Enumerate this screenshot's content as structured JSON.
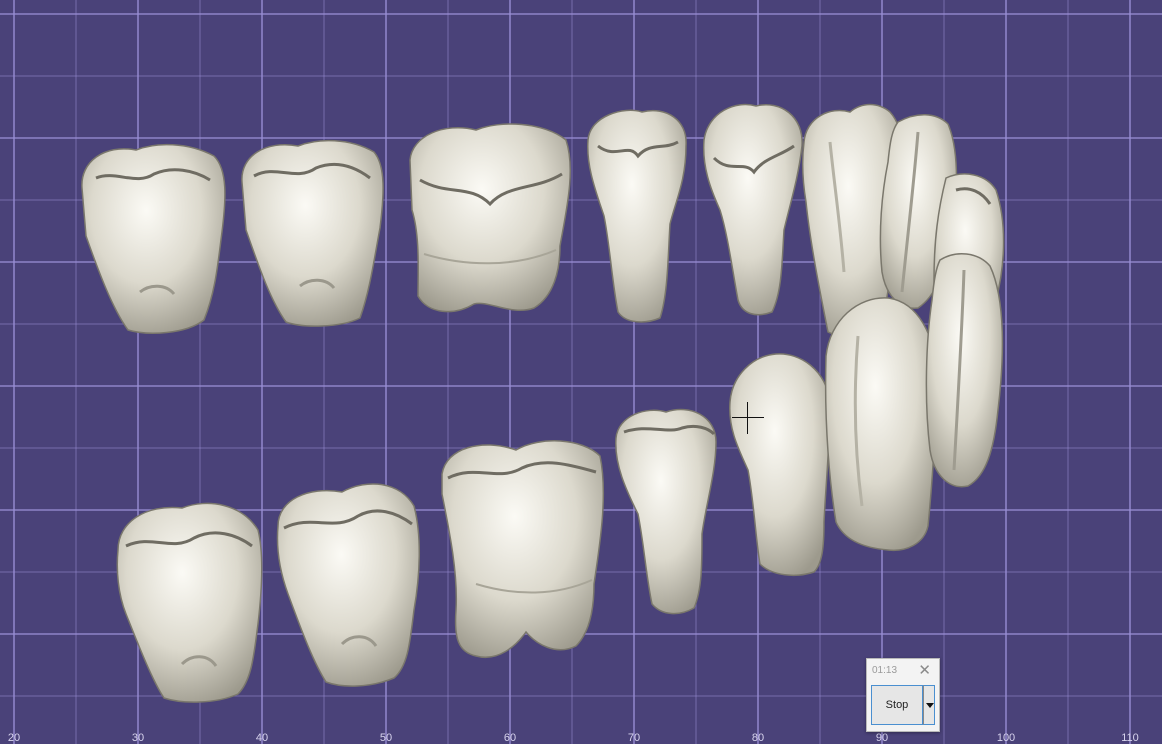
{
  "viewer": {
    "background": "#4a4279",
    "grid_color": "#9a8fd6",
    "tooth_color": "#e6e4da"
  },
  "ruler": {
    "labels": [
      "20",
      "30",
      "40",
      "50",
      "60",
      "70",
      "80",
      "90",
      "100",
      "110"
    ]
  },
  "recorder": {
    "time": "01:13",
    "close_symbol": "✕",
    "stop_label": "Stop"
  }
}
